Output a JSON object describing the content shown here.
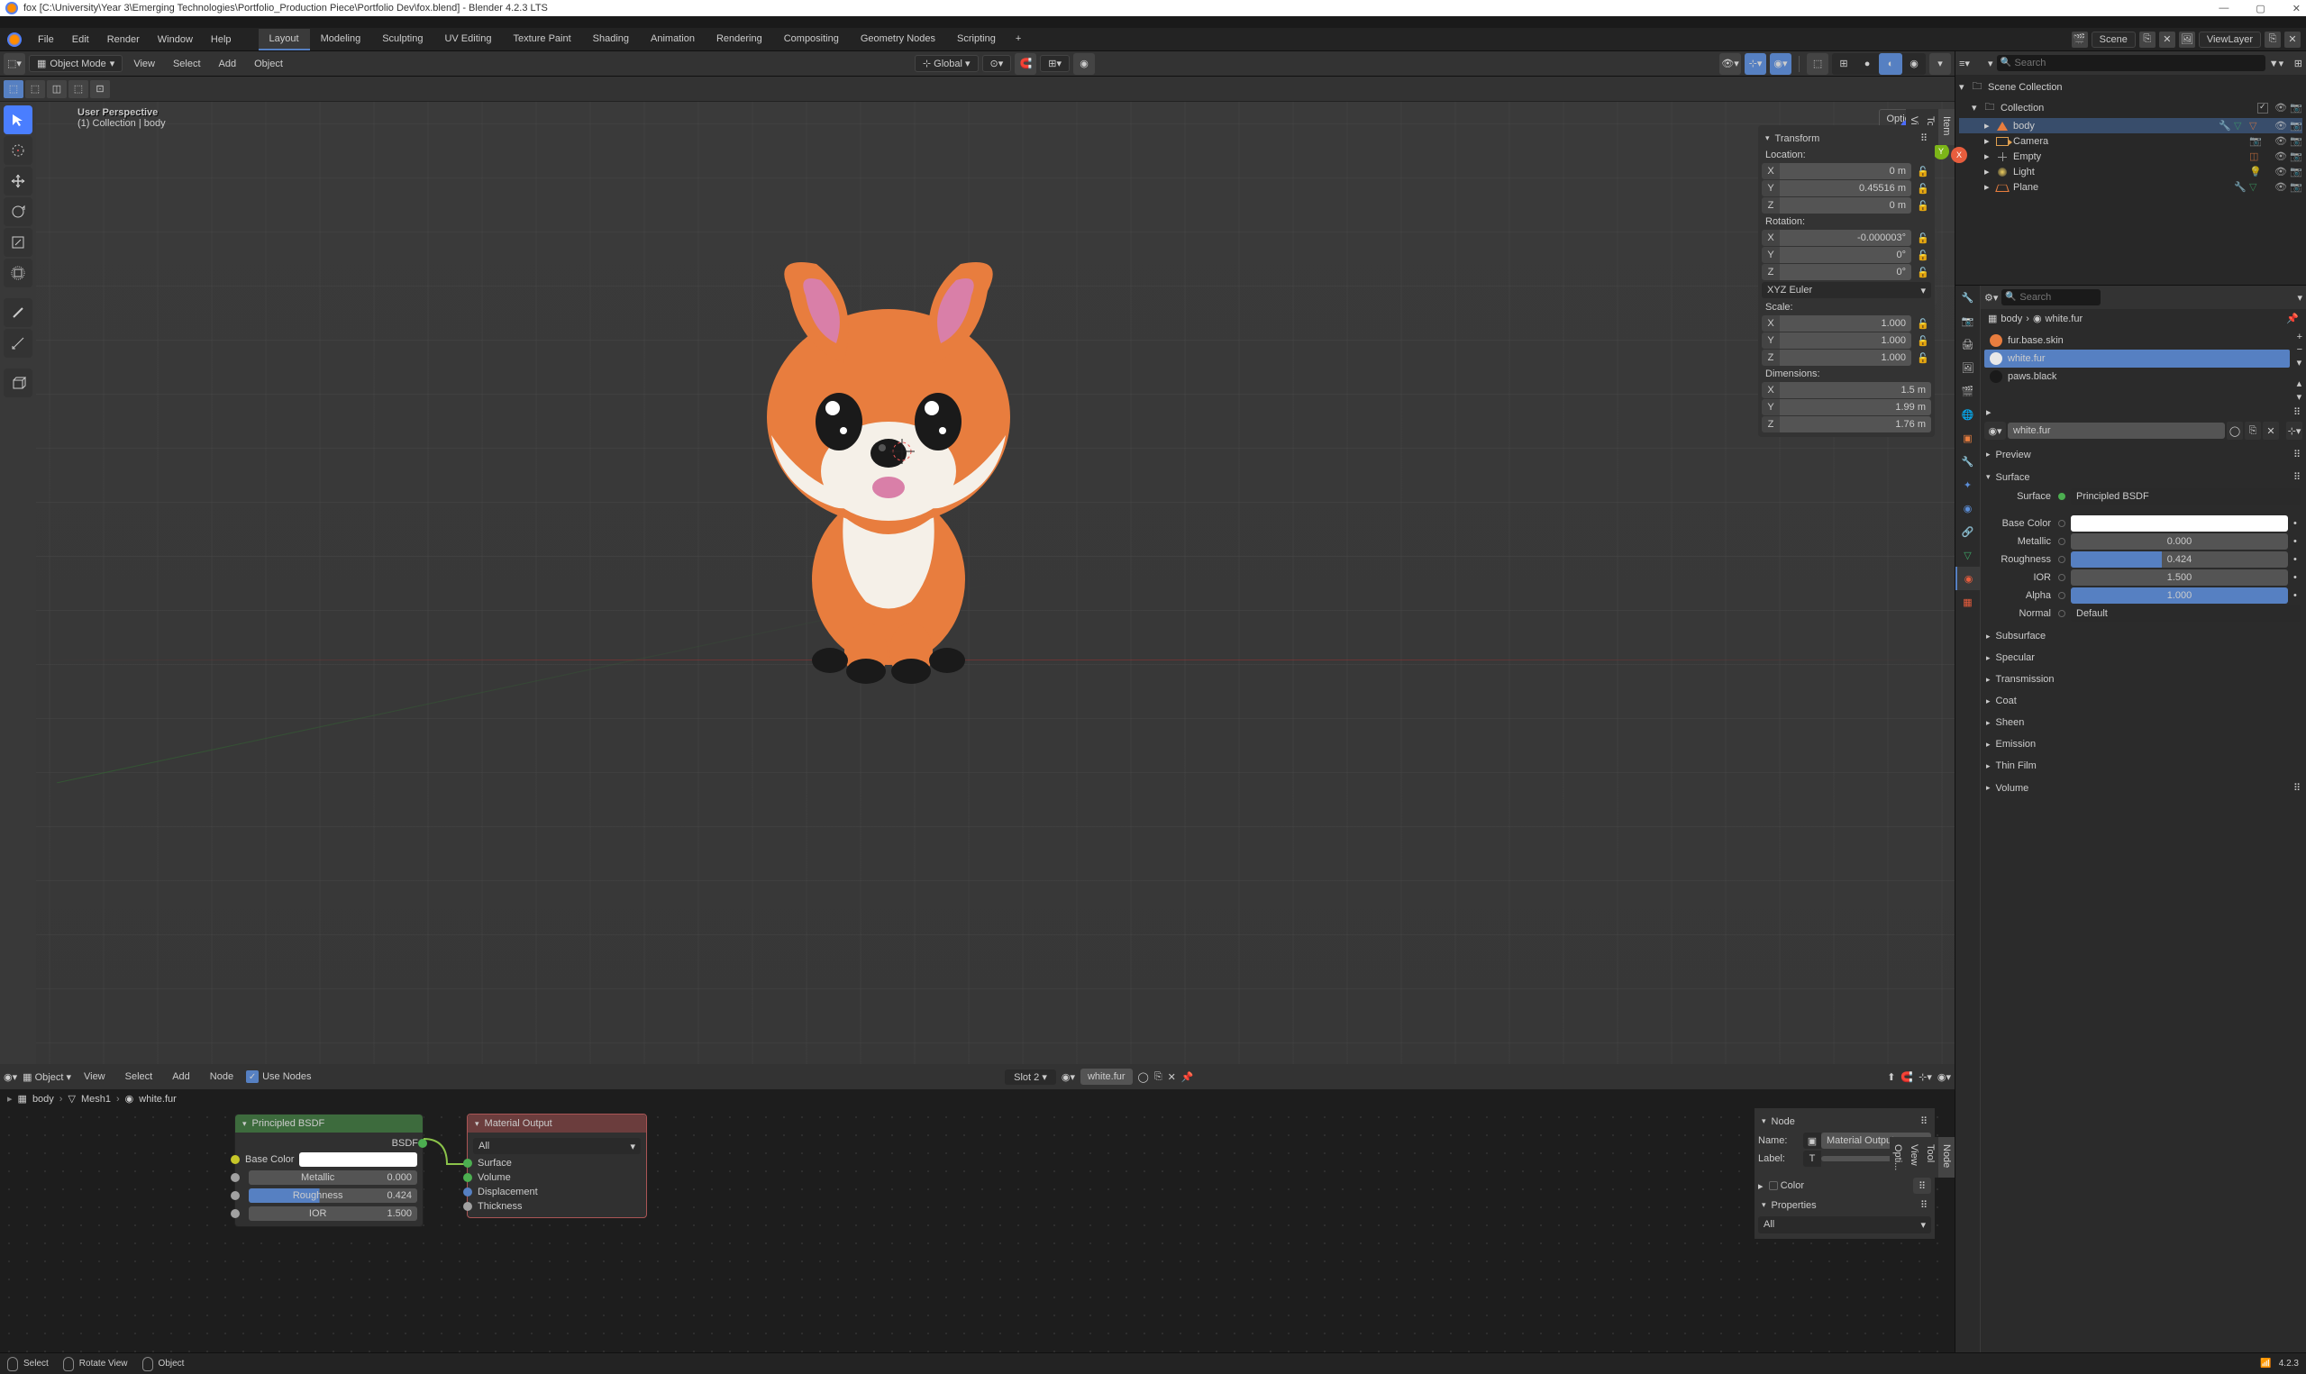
{
  "window": {
    "title": "fox [C:\\University\\Year 3\\Emerging Technologies\\Portfolio_Production Piece\\Portfolio Dev\\fox.blend] - Blender 4.2.3 LTS"
  },
  "menubar": {
    "items": [
      "File",
      "Edit",
      "Render",
      "Window",
      "Help"
    ],
    "workspaces": [
      "Layout",
      "Modeling",
      "Sculpting",
      "UV Editing",
      "Texture Paint",
      "Shading",
      "Animation",
      "Rendering",
      "Compositing",
      "Geometry Nodes",
      "Scripting"
    ],
    "active_workspace": "Layout",
    "scene_label": "Scene",
    "viewlayer_label": "ViewLayer"
  },
  "viewport": {
    "mode": "Object Mode",
    "menus": [
      "View",
      "Select",
      "Add",
      "Object"
    ],
    "orientation": "Global",
    "overlay_text": {
      "line1": "User Perspective",
      "line2": "(1) Collection | body"
    },
    "options_label": "Options",
    "gizmo": {
      "x": "X",
      "y": "Y",
      "z": "Z"
    },
    "n_panel_tabs": [
      "Item",
      "Tool",
      "View"
    ],
    "transform": {
      "header": "Transform",
      "location_label": "Location:",
      "location": {
        "x": "0 m",
        "y": "0.45516 m",
        "z": "0 m"
      },
      "rotation_label": "Rotation:",
      "rotation": {
        "x": "-0.000003°",
        "y": "0°",
        "z": "0°"
      },
      "rotation_mode": "XYZ Euler",
      "scale_label": "Scale:",
      "scale": {
        "x": "1.000",
        "y": "1.000",
        "z": "1.000"
      },
      "dimensions_label": "Dimensions:",
      "dimensions": {
        "x": "1.5 m",
        "y": "1.99 m",
        "z": "1.76 m"
      }
    }
  },
  "outliner": {
    "search_placeholder": "Search",
    "root": "Scene Collection",
    "collection": "Collection",
    "items": [
      {
        "name": "body",
        "type": "mesh",
        "active": true
      },
      {
        "name": "Camera",
        "type": "camera"
      },
      {
        "name": "Empty",
        "type": "empty"
      },
      {
        "name": "Light",
        "type": "light"
      },
      {
        "name": "Plane",
        "type": "plane"
      }
    ]
  },
  "properties": {
    "search_placeholder": "Search",
    "breadcrumb": {
      "obj": "body",
      "mat": "white.fur"
    },
    "material_slots": [
      {
        "name": "fur.base.skin",
        "color": "#e87d3e"
      },
      {
        "name": "white.fur",
        "color": "#e8e8e8",
        "active": true
      },
      {
        "name": "paws.black",
        "color": "#1a1a1a"
      }
    ],
    "material_name": "white.fur",
    "sections": {
      "preview": "Preview",
      "surface": "Surface",
      "volume": "Volume",
      "subsurface": "Subsurface",
      "specular": "Specular",
      "transmission": "Transmission",
      "coat": "Coat",
      "sheen": "Sheen",
      "emission": "Emission",
      "thin_film": "Thin Film"
    },
    "surface": {
      "surface_label": "Surface",
      "surface_value": "Principled BSDF",
      "base_color_label": "Base Color",
      "metallic_label": "Metallic",
      "metallic_value": "0.000",
      "roughness_label": "Roughness",
      "roughness_value": "0.424",
      "ior_label": "IOR",
      "ior_value": "1.500",
      "alpha_label": "Alpha",
      "alpha_value": "1.000",
      "normal_label": "Normal",
      "normal_value": "Default"
    }
  },
  "node_editor": {
    "object_label": "Object",
    "menus": [
      "View",
      "Select",
      "Add",
      "Node"
    ],
    "use_nodes_label": "Use Nodes",
    "slot_label": "Slot 2",
    "material_name": "white.fur",
    "breadcrumb": {
      "obj": "body",
      "mesh": "Mesh1",
      "mat": "white.fur"
    },
    "side_tabs": [
      "Node",
      "Tool",
      "View",
      "Opti..."
    ],
    "nodes": {
      "principled": {
        "title": "Principled BSDF",
        "output": "BSDF",
        "base_color_label": "Base Color",
        "metallic_label": "Metallic",
        "metallic_value": "0.000",
        "roughness_label": "Roughness",
        "roughness_value": "0.424",
        "ior_label": "IOR",
        "ior_value": "1.500"
      },
      "output": {
        "title": "Material Output",
        "target": "All",
        "surface": "Surface",
        "volume": "Volume",
        "displacement": "Displacement",
        "thickness": "Thickness"
      }
    },
    "node_props": {
      "node_header": "Node",
      "name_label": "Name:",
      "name_value": "Material Output",
      "label_label": "Label:",
      "color_header": "Color",
      "properties_header": "Properties",
      "properties_value": "All"
    }
  },
  "statusbar": {
    "select": "Select",
    "rotate": "Rotate View",
    "object": "Object",
    "version": "4.2.3"
  }
}
